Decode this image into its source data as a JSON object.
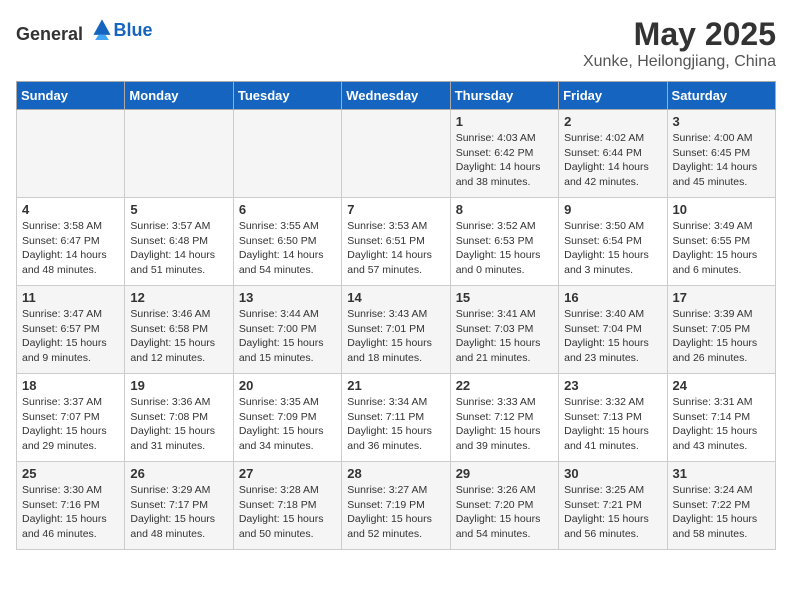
{
  "header": {
    "logo_general": "General",
    "logo_blue": "Blue",
    "month_title": "May 2025",
    "location": "Xunke, Heilongjiang, China"
  },
  "days_of_week": [
    "Sunday",
    "Monday",
    "Tuesday",
    "Wednesday",
    "Thursday",
    "Friday",
    "Saturday"
  ],
  "weeks": [
    [
      {
        "day": "",
        "info": ""
      },
      {
        "day": "",
        "info": ""
      },
      {
        "day": "",
        "info": ""
      },
      {
        "day": "",
        "info": ""
      },
      {
        "day": "1",
        "info": "Sunrise: 4:03 AM\nSunset: 6:42 PM\nDaylight: 14 hours\nand 38 minutes."
      },
      {
        "day": "2",
        "info": "Sunrise: 4:02 AM\nSunset: 6:44 PM\nDaylight: 14 hours\nand 42 minutes."
      },
      {
        "day": "3",
        "info": "Sunrise: 4:00 AM\nSunset: 6:45 PM\nDaylight: 14 hours\nand 45 minutes."
      }
    ],
    [
      {
        "day": "4",
        "info": "Sunrise: 3:58 AM\nSunset: 6:47 PM\nDaylight: 14 hours\nand 48 minutes."
      },
      {
        "day": "5",
        "info": "Sunrise: 3:57 AM\nSunset: 6:48 PM\nDaylight: 14 hours\nand 51 minutes."
      },
      {
        "day": "6",
        "info": "Sunrise: 3:55 AM\nSunset: 6:50 PM\nDaylight: 14 hours\nand 54 minutes."
      },
      {
        "day": "7",
        "info": "Sunrise: 3:53 AM\nSunset: 6:51 PM\nDaylight: 14 hours\nand 57 minutes."
      },
      {
        "day": "8",
        "info": "Sunrise: 3:52 AM\nSunset: 6:53 PM\nDaylight: 15 hours\nand 0 minutes."
      },
      {
        "day": "9",
        "info": "Sunrise: 3:50 AM\nSunset: 6:54 PM\nDaylight: 15 hours\nand 3 minutes."
      },
      {
        "day": "10",
        "info": "Sunrise: 3:49 AM\nSunset: 6:55 PM\nDaylight: 15 hours\nand 6 minutes."
      }
    ],
    [
      {
        "day": "11",
        "info": "Sunrise: 3:47 AM\nSunset: 6:57 PM\nDaylight: 15 hours\nand 9 minutes."
      },
      {
        "day": "12",
        "info": "Sunrise: 3:46 AM\nSunset: 6:58 PM\nDaylight: 15 hours\nand 12 minutes."
      },
      {
        "day": "13",
        "info": "Sunrise: 3:44 AM\nSunset: 7:00 PM\nDaylight: 15 hours\nand 15 minutes."
      },
      {
        "day": "14",
        "info": "Sunrise: 3:43 AM\nSunset: 7:01 PM\nDaylight: 15 hours\nand 18 minutes."
      },
      {
        "day": "15",
        "info": "Sunrise: 3:41 AM\nSunset: 7:03 PM\nDaylight: 15 hours\nand 21 minutes."
      },
      {
        "day": "16",
        "info": "Sunrise: 3:40 AM\nSunset: 7:04 PM\nDaylight: 15 hours\nand 23 minutes."
      },
      {
        "day": "17",
        "info": "Sunrise: 3:39 AM\nSunset: 7:05 PM\nDaylight: 15 hours\nand 26 minutes."
      }
    ],
    [
      {
        "day": "18",
        "info": "Sunrise: 3:37 AM\nSunset: 7:07 PM\nDaylight: 15 hours\nand 29 minutes."
      },
      {
        "day": "19",
        "info": "Sunrise: 3:36 AM\nSunset: 7:08 PM\nDaylight: 15 hours\nand 31 minutes."
      },
      {
        "day": "20",
        "info": "Sunrise: 3:35 AM\nSunset: 7:09 PM\nDaylight: 15 hours\nand 34 minutes."
      },
      {
        "day": "21",
        "info": "Sunrise: 3:34 AM\nSunset: 7:11 PM\nDaylight: 15 hours\nand 36 minutes."
      },
      {
        "day": "22",
        "info": "Sunrise: 3:33 AM\nSunset: 7:12 PM\nDaylight: 15 hours\nand 39 minutes."
      },
      {
        "day": "23",
        "info": "Sunrise: 3:32 AM\nSunset: 7:13 PM\nDaylight: 15 hours\nand 41 minutes."
      },
      {
        "day": "24",
        "info": "Sunrise: 3:31 AM\nSunset: 7:14 PM\nDaylight: 15 hours\nand 43 minutes."
      }
    ],
    [
      {
        "day": "25",
        "info": "Sunrise: 3:30 AM\nSunset: 7:16 PM\nDaylight: 15 hours\nand 46 minutes."
      },
      {
        "day": "26",
        "info": "Sunrise: 3:29 AM\nSunset: 7:17 PM\nDaylight: 15 hours\nand 48 minutes."
      },
      {
        "day": "27",
        "info": "Sunrise: 3:28 AM\nSunset: 7:18 PM\nDaylight: 15 hours\nand 50 minutes."
      },
      {
        "day": "28",
        "info": "Sunrise: 3:27 AM\nSunset: 7:19 PM\nDaylight: 15 hours\nand 52 minutes."
      },
      {
        "day": "29",
        "info": "Sunrise: 3:26 AM\nSunset: 7:20 PM\nDaylight: 15 hours\nand 54 minutes."
      },
      {
        "day": "30",
        "info": "Sunrise: 3:25 AM\nSunset: 7:21 PM\nDaylight: 15 hours\nand 56 minutes."
      },
      {
        "day": "31",
        "info": "Sunrise: 3:24 AM\nSunset: 7:22 PM\nDaylight: 15 hours\nand 58 minutes."
      }
    ]
  ]
}
